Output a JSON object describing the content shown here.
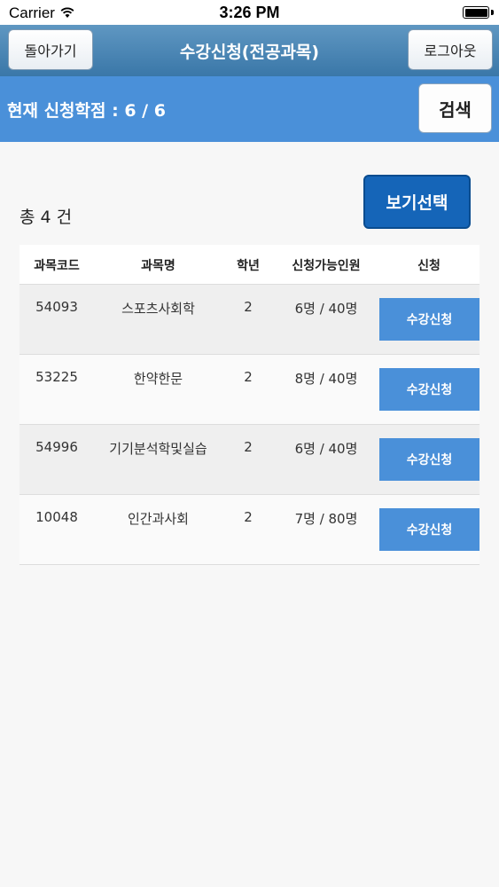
{
  "status_bar": {
    "carrier": "Carrier",
    "time": "3:26 PM"
  },
  "navbar": {
    "back_label": "돌아가기",
    "title": "수강신청(전공과목)",
    "logout_label": "로그아웃"
  },
  "subbar": {
    "credit_text": "현재 신청학점 : 6 / 6",
    "search_label": "검색"
  },
  "view_select_label": "보기선택",
  "total_text": "총 4 건",
  "table": {
    "headers": {
      "code": "과목코드",
      "name": "과목명",
      "year": "학년",
      "capacity": "신청가능인원",
      "apply": "신청"
    },
    "rows": [
      {
        "code": "54093",
        "name": "스포츠사회학",
        "year": "2",
        "capacity": "6명 / 40명",
        "apply": "수강신청"
      },
      {
        "code": "53225",
        "name": "한약한문",
        "year": "2",
        "capacity": "8명 / 40명",
        "apply": "수강신청"
      },
      {
        "code": "54996",
        "name": "기기분석학및실습",
        "year": "2",
        "capacity": "6명 / 40명",
        "apply": "수강신청"
      },
      {
        "code": "10048",
        "name": "인간과사회",
        "year": "2",
        "capacity": "7명 / 80명",
        "apply": "수강신청"
      }
    ]
  },
  "colors": {
    "navbar": "#4a84b6",
    "subbar": "#4a90d9",
    "view_button": "#1565b8",
    "apply_button": "#4a90d9"
  },
  "icons": {
    "wifi": "wifi-icon",
    "battery": "battery-icon"
  }
}
